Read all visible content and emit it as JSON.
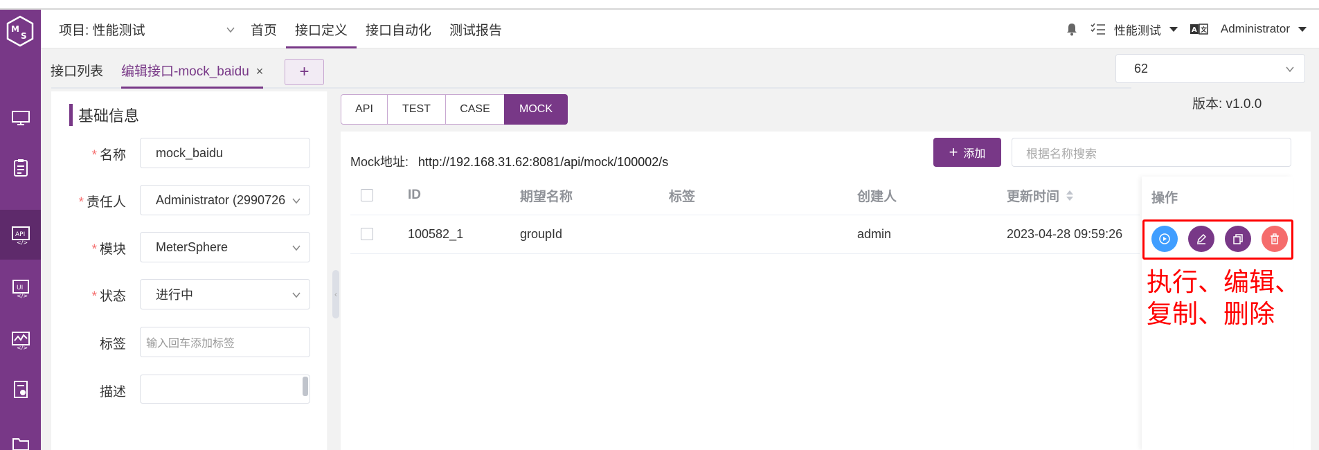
{
  "colors": {
    "brand": "#783887",
    "run": "#409eff",
    "danger": "#f56c6c",
    "annotation": "#ff0000"
  },
  "sidebar": {
    "logo": "ms-logo-icon",
    "items": [
      {
        "icon": "monitor-icon"
      },
      {
        "icon": "clipboard-icon"
      },
      {
        "icon": "api-icon",
        "active": true
      },
      {
        "icon": "ui-icon"
      },
      {
        "icon": "performance-icon"
      },
      {
        "icon": "report-icon"
      },
      {
        "icon": "folder-icon"
      }
    ]
  },
  "header": {
    "project_label": "项目: 性能测试",
    "menu": [
      "首页",
      "接口定义",
      "接口自动化",
      "测试报告"
    ],
    "active_menu": "接口定义",
    "workspace": "性能测试",
    "user": "Administrator"
  },
  "tabs": {
    "list_tab": "接口列表",
    "edit_tab": "编辑接口-mock_baidu",
    "close": "×",
    "add": "+"
  },
  "version_select": {
    "value": "62"
  },
  "version_text": "版本: v1.0.0",
  "basic_info": {
    "title": "基础信息",
    "fields": {
      "name": {
        "label": "名称",
        "value": "mock_baidu"
      },
      "owner": {
        "label": "责任人",
        "value": "Administrator (2990726"
      },
      "module": {
        "label": "模块",
        "value": "MeterSphere"
      },
      "status": {
        "label": "状态",
        "value": "进行中"
      },
      "tags": {
        "label": "标签",
        "placeholder": "输入回车添加标签"
      },
      "desc": {
        "label": "描述",
        "value": ""
      }
    }
  },
  "modes": [
    "API",
    "TEST",
    "CASE",
    "MOCK"
  ],
  "active_mode": "MOCK",
  "mock": {
    "url_label": "Mock地址:",
    "url": "http://192.168.31.62:8081/api/mock/100002/s",
    "add_label": "添加",
    "search_placeholder": "根据名称搜索"
  },
  "table": {
    "headers": {
      "id": "ID",
      "name": "期望名称",
      "tag": "标签",
      "creator": "创建人",
      "updated": "更新时间",
      "ops": "操作"
    },
    "rows": [
      {
        "id": "100582_1",
        "name": "groupId",
        "tag": "",
        "creator": "admin",
        "updated": "2023-04-28 09:59:26"
      }
    ]
  },
  "annotation": {
    "line1": "执行、编辑、",
    "line2": "复制、删除"
  }
}
